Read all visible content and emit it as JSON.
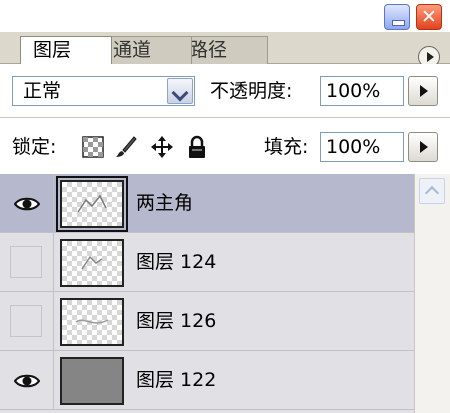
{
  "tabs": [
    {
      "label": "图层"
    },
    {
      "label": "通道"
    },
    {
      "label": "路径"
    }
  ],
  "controls": {
    "blend_mode": "正常",
    "opacity_label": "不透明度:",
    "opacity_value": "100%",
    "lock_label": "锁定:",
    "fill_label": "填充:",
    "fill_value": "100%"
  },
  "layers": [
    {
      "name": "两主角",
      "visible": true,
      "selected": true
    },
    {
      "name": "图层 124",
      "visible": false,
      "selected": false
    },
    {
      "name": "图层 126",
      "visible": false,
      "selected": false
    },
    {
      "name": "图层 122",
      "visible": true,
      "selected": false
    }
  ],
  "colors": {
    "selected_row": "#b6b9cd",
    "panel_bg": "#e9e7dd",
    "list_bg": "#e1e0e5"
  }
}
